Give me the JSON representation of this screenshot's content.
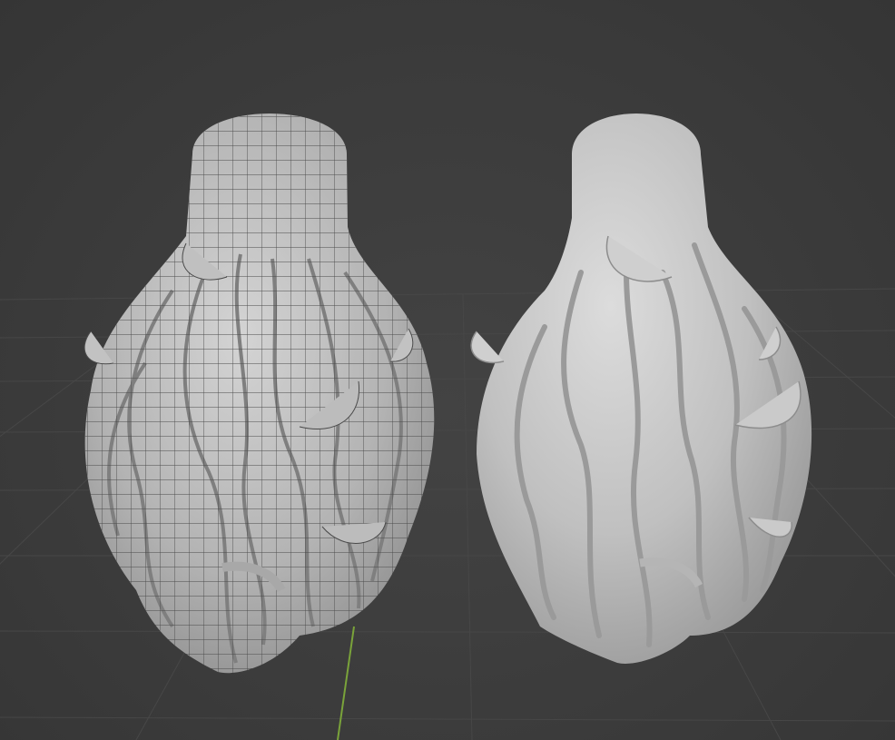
{
  "viewport": {
    "background_color": "#3d3d3d",
    "grid_color": "#4a4a4a",
    "y_axis_color": "#7aa33a"
  },
  "objects": [
    {
      "name": "hair-mesh-wireframe",
      "shading": "solid-with-wireframe",
      "color": "#b8b8b8"
    },
    {
      "name": "hair-mesh-smooth",
      "shading": "solid-smooth",
      "color": "#c4c4c4"
    }
  ]
}
